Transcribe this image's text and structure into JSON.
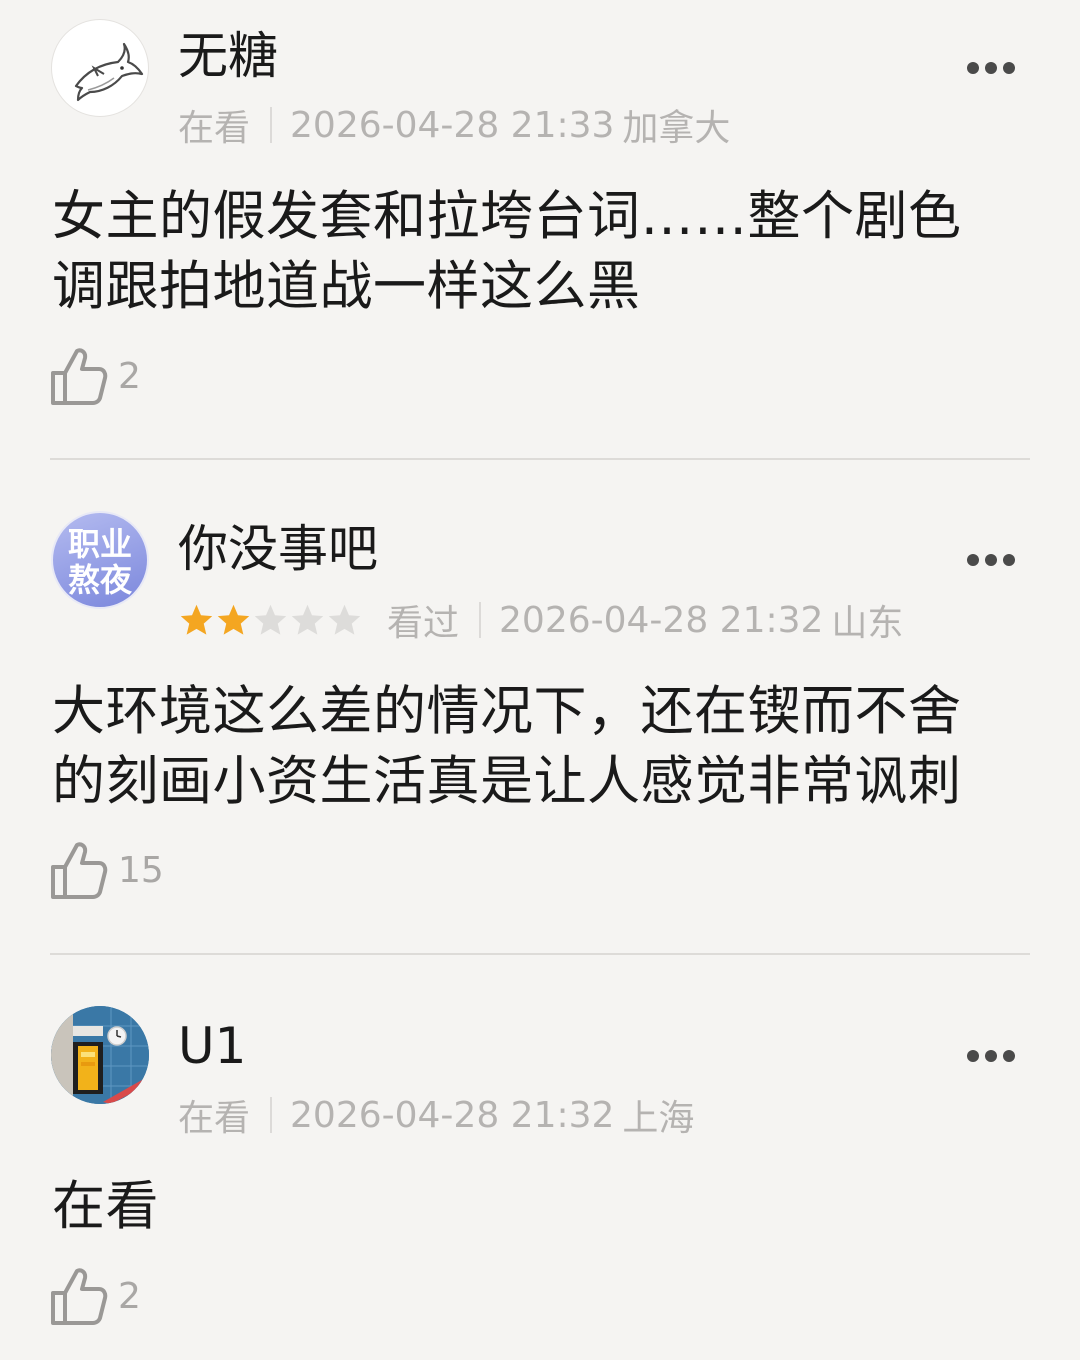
{
  "comments": [
    {
      "username": "无糖",
      "status": "在看",
      "datetime": "2026-04-28 21:33",
      "location": "加拿大",
      "text": "女主的假发套和拉垮台词……整个剧色调跟拍地道战一样这么黑",
      "likes": "2",
      "avatar_icon": "shark-icon"
    },
    {
      "username": "你没事吧",
      "rating": 2,
      "rating_max": 5,
      "status": "看过",
      "datetime": "2026-04-28 21:32",
      "location": "山东",
      "text": "大环境这么差的情况下，还在锲而不舍的刻画小资生活真是让人感觉非常讽刺",
      "likes": "15",
      "avatar_text_line1": "职业",
      "avatar_text_line2": "熬夜"
    },
    {
      "username": "U1",
      "status": "在看",
      "datetime": "2026-04-28 21:32",
      "location": "上海",
      "text": "在看",
      "likes": "2",
      "avatar_icon": "station-photo-icon"
    }
  ],
  "colors": {
    "background": "#f5f4f2",
    "star_filled": "#f4a621",
    "star_empty": "#dddcda",
    "meta_text": "#b5b3b1",
    "avatar2_gradient_top": "#a8b0ec",
    "avatar2_gradient_bottom": "#7a86dc"
  }
}
